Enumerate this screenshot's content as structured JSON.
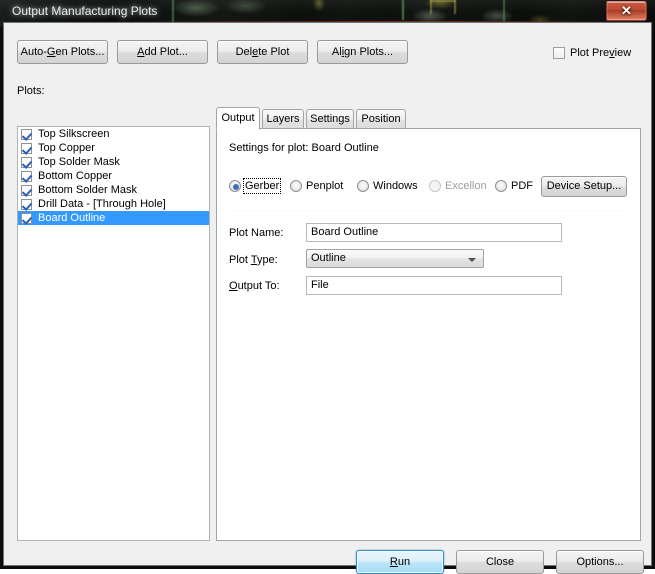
{
  "window": {
    "title": "Output Manufacturing Plots",
    "close_label": "✕",
    "close_icon": "close-icon"
  },
  "toolbar": {
    "buttons": [
      {
        "label": "Auto-Gen Plots...",
        "mnemonic_index": 5
      },
      {
        "label": "Add Plot...",
        "mnemonic_index": 0
      },
      {
        "label": "Delete Plot",
        "mnemonic_index": 3
      },
      {
        "label": "Align Plots...",
        "mnemonic_index": 2
      }
    ],
    "plot_preview": {
      "label": "Plot Preview",
      "checked": false,
      "mnemonic_index": 8
    }
  },
  "plots_panel": {
    "label": "Plots:",
    "items": [
      {
        "label": "Top Silkscreen",
        "checked": true,
        "selected": false
      },
      {
        "label": "Top Copper",
        "checked": true,
        "selected": false
      },
      {
        "label": "Top Solder Mask",
        "checked": true,
        "selected": false
      },
      {
        "label": "Bottom Copper",
        "checked": true,
        "selected": false
      },
      {
        "label": "Bottom Solder Mask",
        "checked": true,
        "selected": false
      },
      {
        "label": "Drill Data - [Through Hole]",
        "checked": true,
        "selected": false
      },
      {
        "label": "Board Outline",
        "checked": true,
        "selected": true
      }
    ]
  },
  "tabs": [
    {
      "label": "Output",
      "active": true
    },
    {
      "label": "Layers",
      "active": false
    },
    {
      "label": "Settings",
      "active": false
    },
    {
      "label": "Position",
      "active": false
    }
  ],
  "output_tab": {
    "heading": "Settings for plot: Board Outline",
    "device_radios": [
      {
        "label": "Gerber",
        "checked": true,
        "disabled": false,
        "focused": true
      },
      {
        "label": "Penplot",
        "checked": false,
        "disabled": false,
        "focused": false
      },
      {
        "label": "Windows",
        "checked": false,
        "disabled": false,
        "focused": false
      },
      {
        "label": "Excellon",
        "checked": false,
        "disabled": true,
        "focused": false
      },
      {
        "label": "PDF",
        "checked": false,
        "disabled": false,
        "focused": false
      }
    ],
    "device_setup_button": "Device Setup...",
    "fields": {
      "plot_name": {
        "label": "Plot Name:",
        "value": "Board Outline",
        "mnemonic_index": -1
      },
      "plot_type": {
        "label": "Plot Type:",
        "value": "Outline",
        "mnemonic_index": 5
      },
      "output_to": {
        "label": "Output To:",
        "value": "File",
        "mnemonic_index": 0
      }
    }
  },
  "footer": {
    "run": {
      "label": "Run",
      "mnemonic_index": 0,
      "default": true
    },
    "close": {
      "label": "Close",
      "mnemonic_index": -1,
      "default": false
    },
    "options": {
      "label": "Options...",
      "mnemonic_index": -1,
      "default": false
    }
  }
}
